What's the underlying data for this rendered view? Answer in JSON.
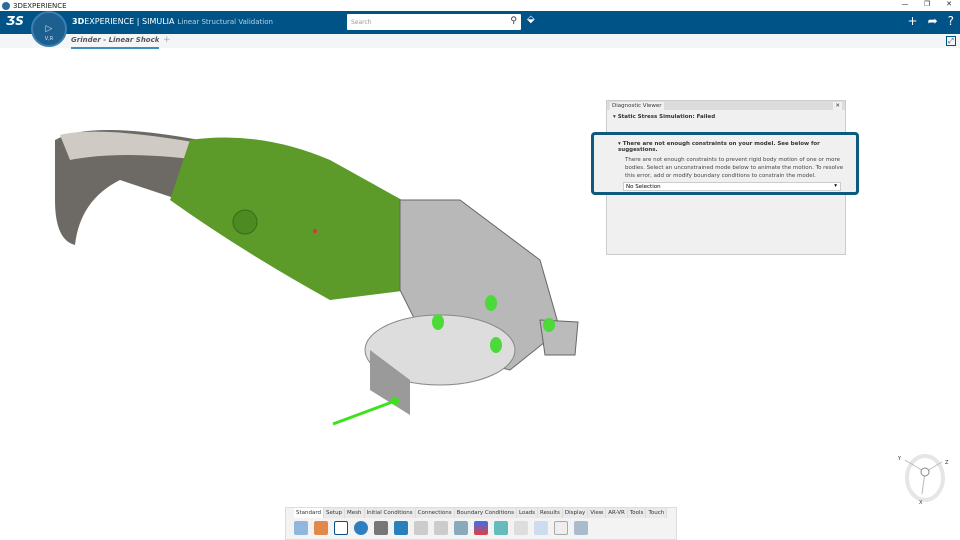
{
  "window": {
    "title": "3DEXPERIENCE",
    "controls": [
      "—",
      "❐",
      "✕"
    ]
  },
  "topbar": {
    "brand_bold": "3D",
    "brand_rest": "EXPERIENCE | SIMULIA",
    "app": "Linear Structural Validation",
    "search_placeholder": "Search",
    "compass_label": "V,R"
  },
  "document_tab": {
    "label": "Grinder - Linear Shock Loa",
    "add": "+"
  },
  "diagnostic": {
    "title": "Diagnostic Viewer",
    "close": "✕",
    "section": "Static Stress Simulation: Failed",
    "issue_title": "There are not enough constraints on your model. See below for suggestions.",
    "issue_text": "There are not enough constraints to prevent rigid body motion of one or more bodies. Select an unconstrained mode below to animate the motion. To resolve this error, add or modify boundary conditions to constrain the model.",
    "selection": "No Selection"
  },
  "toolbar": {
    "tabs": [
      "Standard",
      "Setup",
      "Mesh",
      "Initial Conditions",
      "Connections",
      "Boundary Conditions",
      "Loads",
      "Results",
      "Display",
      "View",
      "AR-VR",
      "Tools",
      "Touch"
    ],
    "active_tab": "Standard"
  },
  "compass_axes": {
    "x": "X",
    "y": "Y",
    "z": "Z"
  },
  "colors": {
    "header": "#005386",
    "highlight": "#0e5a7e",
    "model_green": "#5c9a2a"
  }
}
